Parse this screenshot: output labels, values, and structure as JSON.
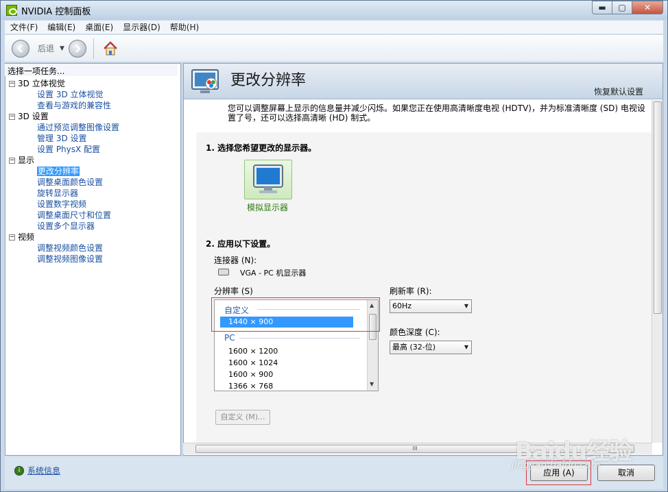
{
  "window": {
    "title": "NVIDIA 控制面板",
    "minimize": "▬",
    "maximize": "▢",
    "close": "✕"
  },
  "menu": [
    "文件(F)",
    "编辑(E)",
    "桌面(E)",
    "显示器(D)",
    "帮助(H)"
  ],
  "toolbar": {
    "back_label": "后退",
    "dropdown": "▼"
  },
  "left": {
    "header": "选择一项任务...",
    "tree": [
      {
        "label": "3D 立体视觉",
        "children": [
          "设置 3D 立体视觉",
          "查看与游戏的兼容性"
        ]
      },
      {
        "label": "3D 设置",
        "children": [
          "通过预览调整图像设置",
          "管理 3D 设置",
          "设置 PhysX 配置"
        ]
      },
      {
        "label": "显示",
        "children": [
          "更改分辨率",
          "调整桌面颜色设置",
          "旋转显示器",
          "设置数字视频",
          "调整桌面尺寸和位置",
          "设置多个显示器"
        ]
      },
      {
        "label": "视频",
        "children": [
          "调整视频颜色设置",
          "调整视频图像设置"
        ]
      }
    ],
    "selected": "更改分辨率",
    "expander": "−",
    "sysinfo": "系统信息",
    "info_glyph": "i"
  },
  "main": {
    "title": "更改分辨率",
    "restore": "恢复默认设置",
    "description": "您可以调整屏幕上显示的信息量并减少闪烁。如果您正在使用高清晰度电视 (HDTV)，并为标准清晰度 (SD) 电视设置了号，还可以选择高清晰 (HD) 制式。",
    "step1": "1. 选择您希望更改的显示器。",
    "display_name": "模拟显示器",
    "step2": "2. 应用以下设置。",
    "connector_label": "连接器 (N):",
    "connector_value": "VGA - PC 机显示器",
    "resolution_label": "分辨率 (S)",
    "resolution_groups": {
      "custom": "自定义",
      "pc": "PC"
    },
    "resolution_selected": "1440 × 900",
    "resolution_items": [
      "1600 × 1200",
      "1600 × 1024",
      "1600 × 900",
      "1366 × 768"
    ],
    "refresh_label": "刷新率 (R):",
    "refresh_value": "60Hz",
    "depth_label": "颜色深度 (C):",
    "depth_value": "最高 (32-位)",
    "custom_button": "自定义 (M)...",
    "scroll_up": "▲",
    "scroll_down": "▼",
    "hscroll_grip": "III"
  },
  "buttons": {
    "apply": "应用 (A)",
    "cancel": "取消"
  },
  "watermark": {
    "logo": "Baidu经验",
    "sub": "jingyan.baidu.com"
  }
}
